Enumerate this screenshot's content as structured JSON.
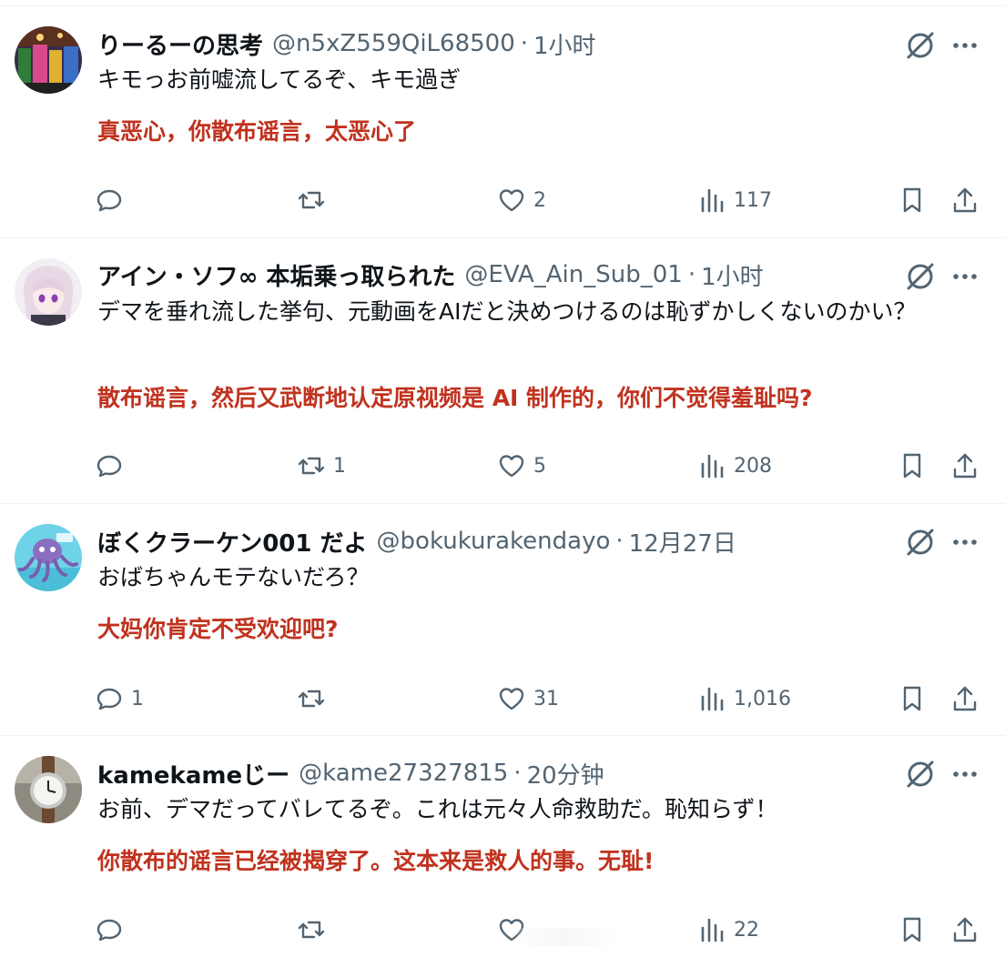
{
  "posts": [
    {
      "display_name": "りーるーの思考",
      "handle": "@n5xZ559QiL68500",
      "dot": "·",
      "time": "1小时",
      "text_jp": "キモっお前嘘流してるぞ、キモ過ぎ",
      "text_zh": "真恶心，你散布谣言，太恶心了",
      "counts": {
        "replies": "",
        "reposts": "",
        "likes": "2",
        "views": "117"
      }
    },
    {
      "display_name": "アイン・ソフ∞ 本垢乗っ取られた",
      "handle": "@EVA_Ain_Sub_01",
      "dot": "·",
      "time": "1小时",
      "text_jp": "デマを垂れ流した挙句、元動画をAIだと決めつけるのは恥ずかしくないのかい？",
      "text_zh": "散布谣言，然后又武断地认定原视频是 AI 制作的，你们不觉得羞耻吗?",
      "counts": {
        "replies": "",
        "reposts": "1",
        "likes": "5",
        "views": "208"
      }
    },
    {
      "display_name": "ぼくクラーケン001 だよ",
      "handle": "@bokukurakendayo",
      "dot": "·",
      "time": "12月27日",
      "text_jp": "おばちゃんモテないだろ？",
      "text_zh": "大妈你肯定不受欢迎吧?",
      "counts": {
        "replies": "1",
        "reposts": "",
        "likes": "31",
        "views": "1,016"
      }
    },
    {
      "display_name": "kamekameじー",
      "handle": "@kame27327815",
      "dot": "·",
      "time": "20分钟",
      "text_jp": "お前、デマだってバレてるぞ。これは元々人命救助だ。恥知らず！",
      "text_zh": "你散布的谣言已经被揭穿了。这本来是救人的事。无耻!",
      "counts": {
        "replies": "",
        "reposts": "",
        "likes": "",
        "views": "22"
      }
    }
  ],
  "icons": {
    "reply": "reply-icon",
    "repost": "repost-icon",
    "like": "heart-icon",
    "views": "views-icon",
    "bookmark": "bookmark-icon",
    "share": "share-icon",
    "grok": "grok-icon",
    "more": "more-icon"
  },
  "colors": {
    "text": "#0f1419",
    "secondary": "#536471",
    "translation_red": "#c0321e",
    "divider": "#eff3f4"
  }
}
